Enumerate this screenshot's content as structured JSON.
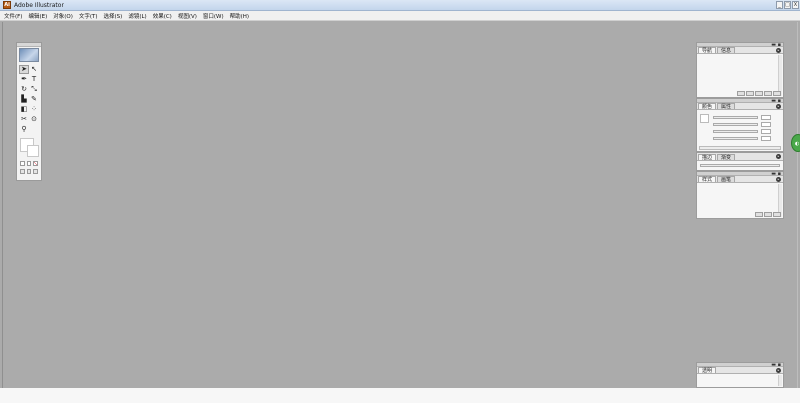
{
  "window": {
    "title": "Adobe Illustrator",
    "app_icon": "Ai",
    "controls": [
      "_",
      "□",
      "X"
    ]
  },
  "menu": [
    "文件(F)",
    "编辑(E)",
    "对象(O)",
    "文字(T)",
    "选择(S)",
    "滤镜(L)",
    "效果(C)",
    "视图(V)",
    "窗口(W)",
    "帮助(H)"
  ],
  "toolbox": {
    "rows": [
      [
        "selection-arrow-icon",
        "direct-select-icon"
      ],
      [
        "pen-icon",
        "type-icon"
      ],
      [
        "rotate-icon",
        "scale-icon"
      ],
      [
        "graph-icon",
        "pencil-icon"
      ],
      [
        "gradient-icon",
        "blend-icon"
      ],
      [
        "scissors-icon",
        "eyedropper-icon"
      ],
      [
        "zoom-icon",
        "hand-icon"
      ]
    ],
    "glyphs": {
      "selection-arrow-icon": "➤",
      "direct-select-icon": "↖",
      "pen-icon": "✒",
      "type-icon": "T",
      "rotate-icon": "↻",
      "scale-icon": "⤡",
      "graph-icon": "▙",
      "pencil-icon": "✎",
      "gradient-icon": "◧",
      "blend-icon": "⁘",
      "scissors-icon": "✂",
      "eyedropper-icon": "⊙",
      "zoom-icon": "⚲",
      "hand-icon": ""
    }
  },
  "panels": {
    "layers": {
      "tabs": [
        "导航",
        "信息"
      ]
    },
    "color": {
      "tabs": [
        "颜色",
        "属性"
      ]
    },
    "stroke": {
      "tabs": [
        "描边",
        "渐变"
      ]
    },
    "styles": {
      "tabs": [
        "样式",
        "画笔"
      ]
    },
    "bottom": {
      "tabs": [
        "透明"
      ]
    }
  },
  "colors": {
    "workspace": "#ababab",
    "accent_green": "#4aa84a"
  }
}
